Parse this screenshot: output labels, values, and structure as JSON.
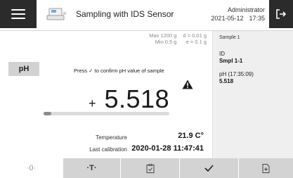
{
  "header": {
    "title": "Sampling with IDS Sensor",
    "user": "Administrator",
    "date": "2021-05-12",
    "time": "17:35",
    "icons": {
      "menu": "hamburger-menu-icon",
      "device": "instrument-icon",
      "logout": "logout-icon"
    }
  },
  "balance_capacity": {
    "max": "Max 1200 g",
    "min": "Min 0.5 g",
    "d": "d = 0.01 g",
    "e": "e = 0.1 g"
  },
  "measurement": {
    "mode_badge": "pH",
    "instruction": "Press ✓ to confirm pH value of sample",
    "sign": "+",
    "value": "5.518",
    "warning_icon": "warning-triangle-icon",
    "progress_fraction": 0.06
  },
  "readings": {
    "temperature_label": "Temperature",
    "temperature_value": "21.9 C°",
    "calibration_label": "Last calibration",
    "calibration_value": "2020-01-28 11:47:41"
  },
  "sample_panel": {
    "title": "Sample 1",
    "id_label": "ID",
    "id_value": "Smpl 1-1",
    "ph_label": "pH (17:35:09)",
    "ph_value": "5.518"
  },
  "toolbar": [
    {
      "label": "·0·",
      "icon": "zero-icon"
    },
    {
      "label": "·T·",
      "icon": "tare-icon"
    },
    {
      "label": "",
      "icon": "clipboard-check-icon"
    },
    {
      "label": "",
      "icon": "checkmark-icon"
    },
    {
      "label": "",
      "icon": "add-document-icon"
    }
  ],
  "colors": {
    "dark": "#2b2b2b",
    "toolbar_grey": "#d3d3d3",
    "panel_bg": "#efefef"
  }
}
